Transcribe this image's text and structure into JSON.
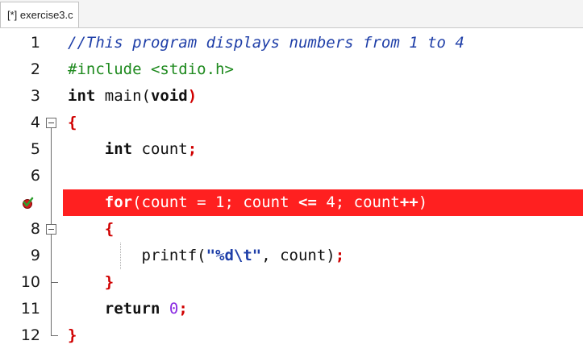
{
  "tab": {
    "label": "[*] exercise3.c"
  },
  "colors": {
    "highlight": "#ff2020",
    "comment": "#1f3fa8",
    "preprocessor": "#1f8a1f",
    "brace": "#d00000",
    "number": "#8a2be2"
  },
  "gutter": {
    "line_numbers": [
      "1",
      "2",
      "3",
      "4",
      "5",
      "6",
      "",
      "8",
      "9",
      "10",
      "11",
      "12"
    ],
    "breakpoint_line": 7,
    "breakpoint_icon": "breakpoint-check-icon"
  },
  "code": {
    "l1_comment": "//This program displays numbers from 1 to 4",
    "l2_include": "#include <stdio.h>",
    "l3_int": "int",
    "l3_main": " main(",
    "l3_void": "void",
    "l3_close": ")",
    "l4_brace": "{",
    "l5_int": "int",
    "l5_rest": " count",
    "l5_semi": ";",
    "l7_for": "for",
    "l7_part1": "(count = 1; count ",
    "l7_op1": "<=",
    "l7_part2": " 4; count",
    "l7_op2": "++",
    "l7_part3": ")",
    "l8_brace": "{",
    "l9_printf": "printf(",
    "l9_str": "\"%d\\t\"",
    "l9_rest": ", count)",
    "l9_semi": ";",
    "l10_brace": "}",
    "l11_return": "return",
    "l11_num": "0",
    "l11_semi": ";",
    "l12_brace": "}"
  }
}
